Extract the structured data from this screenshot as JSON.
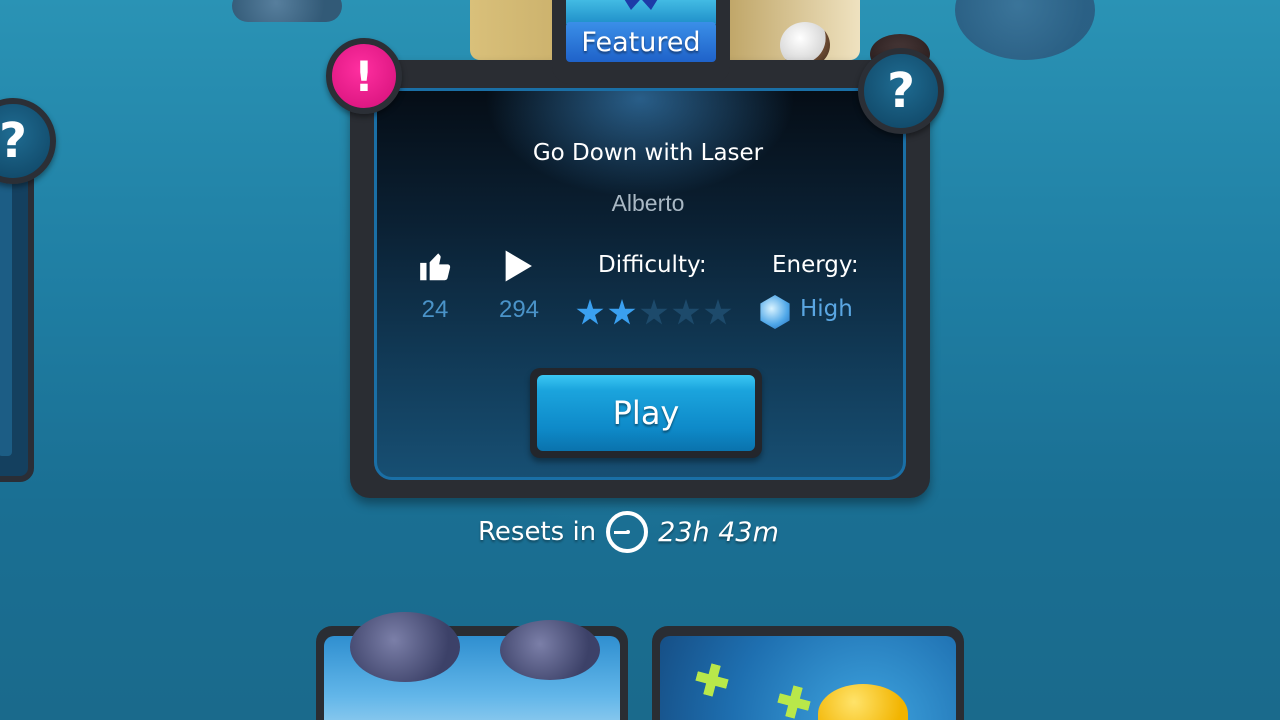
{
  "featured": {
    "label": "Featured"
  },
  "level": {
    "title": "Go Down with Laser",
    "author": "Alberto"
  },
  "stats": {
    "likes": "24",
    "plays": "294",
    "difficulty_label": "Difficulty:",
    "difficulty_stars": 2,
    "difficulty_max": 5,
    "energy_label": "Energy:",
    "energy_value": "High"
  },
  "play_button": {
    "label": "Play"
  },
  "reset": {
    "label": "Resets in",
    "time": "23h 43m"
  },
  "badges": {
    "alert": "!",
    "help": "?"
  },
  "colors": {
    "star_filled": "#3aa0f0",
    "star_empty": "#1d4a6b",
    "accent_blue": "#1ba4dd",
    "alert_pink": "#e61989"
  },
  "icons": [
    "thumbs-up-icon",
    "play-count-icon",
    "star-icon",
    "energy-icon",
    "timer-icon",
    "question-icon",
    "alert-icon"
  ]
}
